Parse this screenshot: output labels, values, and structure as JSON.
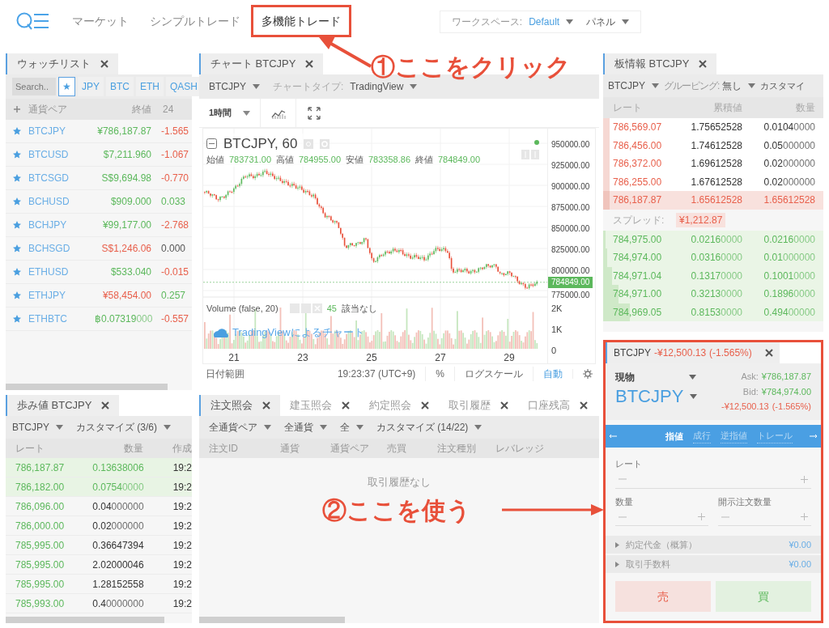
{
  "header": {
    "nav": [
      {
        "label": "マーケット",
        "selected": false,
        "annotated": false
      },
      {
        "label": "シンプルトレード",
        "selected": false,
        "annotated": false
      },
      {
        "label": "多機能トレード",
        "selected": true,
        "annotated": true
      }
    ],
    "workspace": {
      "label": "ワークスペース:",
      "value": "Default",
      "panel": "パネル"
    }
  },
  "watchlist": {
    "tab": "ウォッチリスト",
    "search": {
      "placeholder": "Search.."
    },
    "filters": [
      {
        "label": "★",
        "selected": true
      },
      {
        "label": "JPY",
        "selected": false
      },
      {
        "label": "BTC",
        "selected": false
      },
      {
        "label": "ETH",
        "selected": false
      },
      {
        "label": "QASH",
        "selected": false
      }
    ],
    "columns": [
      "通貨ペア",
      "終値",
      "24"
    ],
    "rows": [
      {
        "pair": "BTCJPY",
        "price": {
          "text": "¥786,187.87",
          "color": "#5cb85c"
        },
        "change": {
          "text": "-1.565",
          "color": "#e8604c"
        }
      },
      {
        "pair": "BTCUSD",
        "price": {
          "text": "$7,211.960",
          "color": "#5cb85c"
        },
        "change": {
          "text": "-1.067",
          "color": "#e8604c"
        }
      },
      {
        "pair": "BTCSGD",
        "price": {
          "text": "S$9,694.98",
          "color": "#5cb85c"
        },
        "change": {
          "text": "-0.770",
          "color": "#e8604c"
        }
      },
      {
        "pair": "BCHUSD",
        "price": {
          "text": "$909.000",
          "color": "#5cb85c"
        },
        "change": {
          "text": "0.033",
          "color": "#5cb85c"
        }
      },
      {
        "pair": "BCHJPY",
        "price": {
          "text": "¥99,177.00",
          "color": "#5cb85c"
        },
        "change": {
          "text": "-2.768",
          "color": "#e8604c"
        }
      },
      {
        "pair": "BCHSGD",
        "price": {
          "text": "S$1,246.06",
          "color": "#e8604c"
        },
        "change": {
          "text": "0.000",
          "color": "#555555"
        }
      },
      {
        "pair": "ETHUSD",
        "price": {
          "text": "$533.040",
          "color": "#5cb85c"
        },
        "change": {
          "text": "-0.015",
          "color": "#e8604c"
        }
      },
      {
        "pair": "ETHJPY",
        "price": {
          "text": "¥58,454.00",
          "color": "#e8604c"
        },
        "change": {
          "text": "0.257",
          "color": "#5cb85c"
        }
      },
      {
        "pair": "ETHBTC",
        "price": {
          "text": "฿0.07319",
          "fade": "000",
          "color": "#5cb85c"
        },
        "change": {
          "text": "-0.557",
          "color": "#e8604c"
        }
      }
    ]
  },
  "chart": {
    "tab": "チャート BTCJPY",
    "symbol": "BTCJPY",
    "chart_type_label": "チャートタイプ:",
    "chart_type": "TradingView",
    "interval": "1時間",
    "legend_title": "BTCJPY, 60",
    "ohlc": [
      {
        "label": "始値",
        "value": "783731.00"
      },
      {
        "label": "高値",
        "value": "784955.00"
      },
      {
        "label": "安値",
        "value": "783358.86"
      },
      {
        "label": "終値",
        "value": "784849.00"
      }
    ],
    "price_labels": [
      "950000.00",
      "925000.00",
      "900000.00",
      "875000.00",
      "850000.00",
      "825000.00",
      "800000.00",
      "775000.00"
    ],
    "last_price": "784849.00",
    "volume_title": "Volume (false, 20)",
    "volume_value": "45",
    "volume_note": "該当なし",
    "volume_labels": [
      "2K",
      "1K",
      "0"
    ],
    "attribution": "TradingViewによるチャート",
    "date_labels": [
      "21",
      "23",
      "25",
      "27",
      "29"
    ],
    "date_range": "日付範囲",
    "time": "19:23:37 (UTC+9)",
    "percent": "%",
    "log_scale": "ログスケール",
    "auto": "自動"
  },
  "order_book": {
    "tab": "板情報 BTCJPY",
    "symbol": "BTCJPY",
    "grouping_label": "グルーピング:",
    "grouping": "無し",
    "customize": "カスタマイ",
    "columns": [
      "レート",
      "累積値",
      "数量"
    ],
    "rows": [
      {
        "kind": "ask",
        "rate": "786,569.07",
        "cum": {
          "text": "1.75652528"
        },
        "qty": {
          "text": "0.0104",
          "fade": "0000"
        },
        "level": 0.03
      },
      {
        "kind": "ask",
        "rate": "786,456.00",
        "cum": {
          "text": "1.74612528"
        },
        "qty": {
          "text": "0.05",
          "fade": "000000"
        },
        "level": 0.03
      },
      {
        "kind": "ask",
        "rate": "786,372.00",
        "cum": {
          "text": "1.69612528"
        },
        "qty": {
          "text": "0.02",
          "fade": "000000"
        },
        "level": 0.03
      },
      {
        "kind": "ask",
        "rate": "786,255.00",
        "cum": {
          "text": "1.67612528"
        },
        "qty": {
          "text": "0.02",
          "fade": "000000"
        },
        "level": 0.03
      },
      {
        "kind": "best_ask",
        "rate": "786,187.87",
        "cum": {
          "text": "1.65612528"
        },
        "qty": {
          "text": "1.65612528"
        },
        "level": 0.03
      },
      {
        "kind": "spread",
        "label": "スプレッド:",
        "value": "¥1,212.87"
      },
      {
        "kind": "bid",
        "rate": "784,975.00",
        "cum": {
          "text": "0.0216",
          "fade": "0000"
        },
        "qty": {
          "text": "0.0216",
          "fade": "0000"
        },
        "level": 0.01
      },
      {
        "kind": "bid",
        "rate": "784,974.00",
        "cum": {
          "text": "0.0316",
          "fade": "0000"
        },
        "qty": {
          "text": "0.01",
          "fade": "000000"
        },
        "level": 0.02
      },
      {
        "kind": "bid",
        "rate": "784,971.04",
        "cum": {
          "text": "0.1317",
          "fade": "0000"
        },
        "qty": {
          "text": "0.1001",
          "fade": "0000"
        },
        "level": 0.04
      },
      {
        "kind": "bid",
        "rate": "784,971.00",
        "cum": {
          "text": "0.3213",
          "fade": "0000"
        },
        "qty": {
          "text": "0.1896",
          "fade": "0000"
        },
        "level": 0.07
      },
      {
        "kind": "bid",
        "rate": "784,969.05",
        "cum": {
          "text": "0.8153",
          "fade": "0000"
        },
        "qty": {
          "text": "0.494",
          "fade": "00000"
        },
        "level": 0.12
      }
    ]
  },
  "trades": {
    "tab": "歩み値 BTCJPY",
    "symbol": "BTCJPY",
    "customize": "カスタマイズ (3/6)",
    "columns": [
      "レート",
      "数量",
      "作成"
    ],
    "rows": [
      {
        "rate": "786,187.87",
        "qty": {
          "text": "0.13638006"
        },
        "time": "19:2",
        "highlighted": true
      },
      {
        "rate": "786,182.00",
        "qty": {
          "text": "0.0754",
          "fade": "0000"
        },
        "time": "19:2",
        "highlighted": true
      },
      {
        "rate": "786,096.00",
        "qty": {
          "text": "0.04",
          "fade": "000000"
        },
        "time": "19:2",
        "highlighted": false
      },
      {
        "rate": "786,000.00",
        "qty": {
          "text": "0.02",
          "fade": "000000"
        },
        "time": "19:2",
        "highlighted": false
      },
      {
        "rate": "785,995.00",
        "qty": {
          "text": "0.36647394"
        },
        "time": "19:2",
        "highlighted": false
      },
      {
        "rate": "785,995.00",
        "qty": {
          "text": "2.02000046"
        },
        "time": "19:2",
        "highlighted": false
      },
      {
        "rate": "785,995.00",
        "qty": {
          "text": "1.28152558"
        },
        "time": "19:2",
        "highlighted": false
      },
      {
        "rate": "785,993.00",
        "qty": {
          "text": "0.4",
          "fade": "0000000"
        },
        "time": "19:2",
        "highlighted": false
      }
    ]
  },
  "orders": {
    "tabs": [
      {
        "label": "注文照会",
        "selected": true
      },
      {
        "label": "建玉照会",
        "selected": false
      },
      {
        "label": "約定照会",
        "selected": false
      },
      {
        "label": "取引履歴",
        "selected": false
      },
      {
        "label": "口座残高",
        "selected": false
      }
    ],
    "filters": [
      "全通貨ペア",
      "全通貨",
      "全",
      "カスタマイズ (14/22)"
    ],
    "columns": [
      "注文ID",
      "通貨",
      "通貨ペア",
      "売買",
      "注文種別",
      "レバレッジ"
    ],
    "empty": "取引履歴なし"
  },
  "order_form": {
    "annotated": true,
    "tab_symbol": "BTCJPY",
    "tab_change": "-¥12,500.13",
    "tab_pct": "(-1.565%)",
    "account": "現物",
    "symbol": "BTCJPY",
    "ask_label": "Ask:",
    "ask": "¥786,187.87",
    "bid_label": "Bid:",
    "bid": "¥784,974.00",
    "change": "-¥12,500.13",
    "change_pct": "(-1.565%)",
    "order_types": [
      {
        "label": "指値",
        "selected": true
      },
      {
        "label": "成行",
        "selected": false
      },
      {
        "label": "逆指値",
        "selected": false
      },
      {
        "label": "トレール",
        "selected": false
      }
    ],
    "rate_label": "レート",
    "qty_label": "数量",
    "display_qty_label": "開示注文数量",
    "summary": [
      {
        "label": "約定代金（概算）",
        "value": "¥0.00"
      },
      {
        "label": "取引手数料",
        "value": "¥0.00"
      }
    ],
    "sell": "売",
    "buy": "買"
  },
  "annotations": [
    {
      "kind": "click_callout",
      "text": "①ここをクリック"
    },
    {
      "kind": "use_callout",
      "text": "②ここを使う"
    }
  ]
}
